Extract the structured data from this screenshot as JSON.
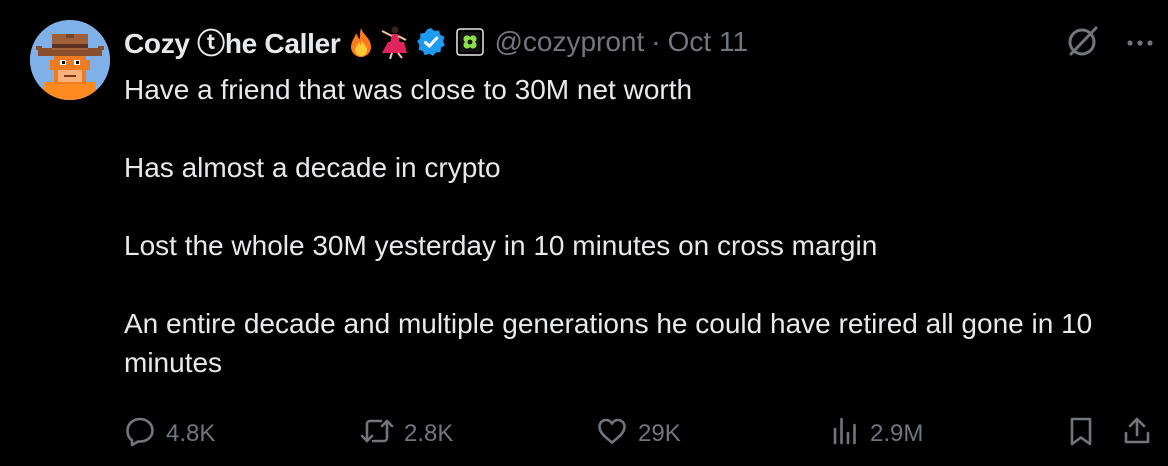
{
  "tweet": {
    "author": {
      "display_name": "Cozy ⓣhe Caller",
      "handle": "@cozypront",
      "verified": true,
      "emojis": [
        "fire",
        "dancer"
      ],
      "affiliate_badge": "green-gem-badge"
    },
    "separator": "·",
    "date": "Oct 11",
    "paragraphs": [
      "Have a friend that was close to 30M net worth",
      "Has almost a decade in crypto",
      "Lost the whole 30M yesterday in 10 minutes on cross margin",
      "An entire decade and multiple generations he could have retired all gone in 10 minutes"
    ],
    "stats": {
      "replies": "4.8K",
      "retweets": "2.8K",
      "likes": "29K",
      "views": "2.9M"
    }
  },
  "colors": {
    "background": "#000000",
    "text": "#e7e9ea",
    "muted": "#71767b",
    "verified_blue": "#1d9bf0"
  }
}
